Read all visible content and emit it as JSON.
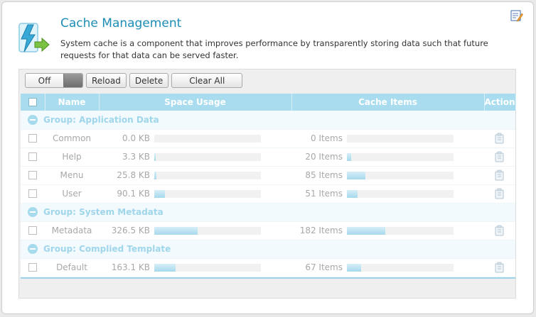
{
  "header": {
    "title": "Cache Management",
    "description": "System cache is a component that improves performance by transparently storing data such that future requests for that data can be served faster."
  },
  "toolbar": {
    "toggle_label": "Off",
    "reload_label": "Reload",
    "delete_label": "Delete",
    "clear_all_label": "Clear All"
  },
  "table": {
    "columns": [
      "Name",
      "Space Usage",
      "Cache Items",
      "Action"
    ],
    "groups": [
      {
        "label": "Group: Application Data",
        "rows": [
          {
            "name": "Common",
            "space": "0.0 KB",
            "space_fill": 0.0,
            "items": "0 Items",
            "items_fill": 0.0
          },
          {
            "name": "Help",
            "space": "3.3 KB",
            "space_fill": 0.01,
            "items": "20 Items",
            "items_fill": 0.04
          },
          {
            "name": "Menu",
            "space": "25.8 KB",
            "space_fill": 0.02,
            "items": "85 Items",
            "items_fill": 0.17
          },
          {
            "name": "User",
            "space": "90.1 KB",
            "space_fill": 0.1,
            "items": "51 Items",
            "items_fill": 0.1
          }
        ]
      },
      {
        "label": "Group: System Metadata",
        "rows": [
          {
            "name": "Metadata",
            "space": "326.5 KB",
            "space_fill": 0.41,
            "items": "182 Items",
            "items_fill": 0.36
          }
        ]
      },
      {
        "label": "Group: Complied Template",
        "rows": [
          {
            "name": "Default",
            "space": "163.1 KB",
            "space_fill": 0.2,
            "items": "67 Items",
            "items_fill": 0.13
          }
        ]
      }
    ]
  },
  "colors": {
    "title": "#1e8db5",
    "header_bg": "#a9dcef",
    "group_text": "#9fd6eb",
    "bar_fill": "#a6d8ed"
  }
}
